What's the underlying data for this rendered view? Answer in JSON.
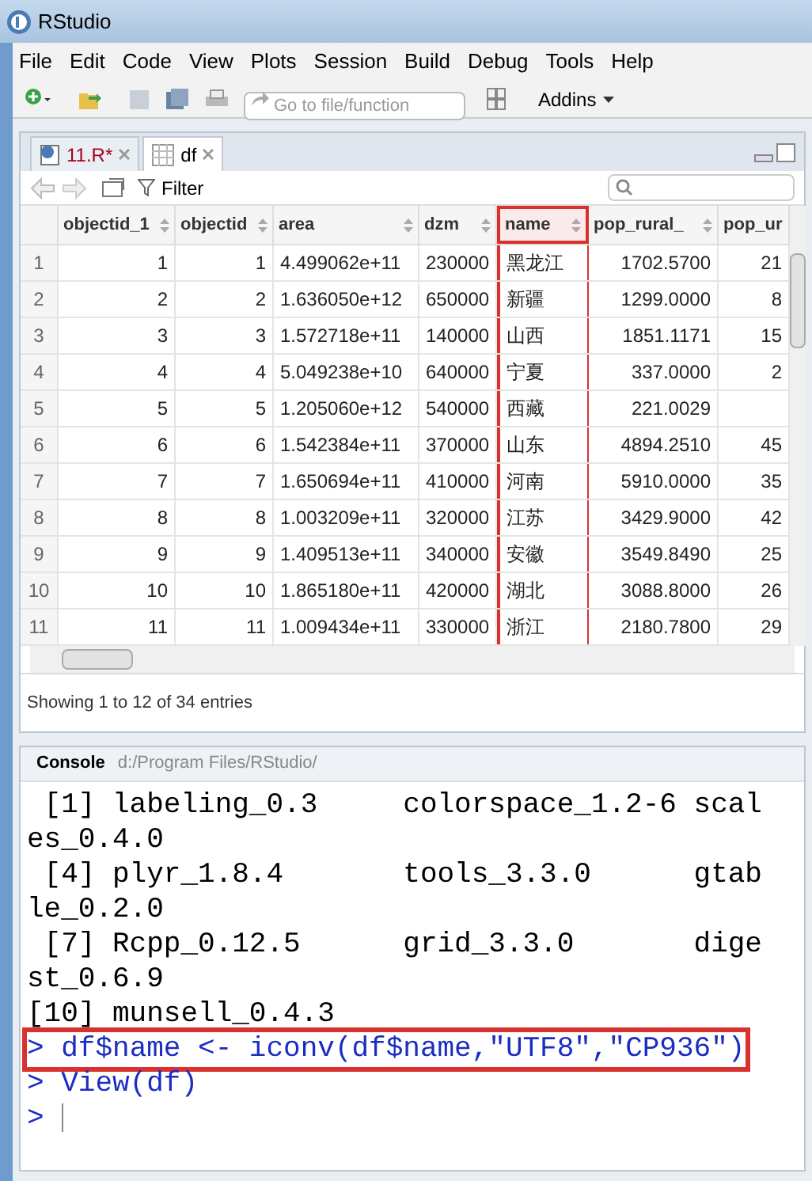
{
  "window": {
    "title": "RStudio"
  },
  "menu": [
    "File",
    "Edit",
    "Code",
    "View",
    "Plots",
    "Session",
    "Build",
    "Debug",
    "Tools",
    "Help"
  ],
  "toolbar": {
    "goto_placeholder": "Go to file/function",
    "addins": "Addins"
  },
  "tabs": [
    {
      "label": "11.R*",
      "kind": "script",
      "selected": false
    },
    {
      "label": "df",
      "kind": "data",
      "selected": true
    }
  ],
  "viewer": {
    "filter": "Filter",
    "columns": [
      {
        "label": "objectid_1",
        "kind": "integer",
        "highlighted": false
      },
      {
        "label": "objectid",
        "kind": "integer",
        "highlighted": false
      },
      {
        "label": "area",
        "kind": "scientific",
        "highlighted": false
      },
      {
        "label": "dzm",
        "kind": "code",
        "highlighted": false
      },
      {
        "label": "name",
        "kind": "text",
        "highlighted": true
      },
      {
        "label": "pop_rural_",
        "kind": "decimal",
        "highlighted": false
      },
      {
        "label": "pop_ur",
        "kind": "cut",
        "highlighted": false
      }
    ],
    "rows": [
      {
        "number": "1",
        "cells": [
          "1",
          "1",
          "4.499062e+11",
          "230000",
          "黑龙江",
          "1702.5700",
          "21"
        ]
      },
      {
        "number": "2",
        "cells": [
          "2",
          "2",
          "1.636050e+12",
          "650000",
          "新疆",
          "1299.0000",
          "8"
        ]
      },
      {
        "number": "3",
        "cells": [
          "3",
          "3",
          "1.572718e+11",
          "140000",
          "山西",
          "1851.1171",
          "15"
        ]
      },
      {
        "number": "4",
        "cells": [
          "4",
          "4",
          "5.049238e+10",
          "640000",
          "宁夏",
          "337.0000",
          "2"
        ]
      },
      {
        "number": "5",
        "cells": [
          "5",
          "5",
          "1.205060e+12",
          "540000",
          "西藏",
          "221.0029",
          ""
        ]
      },
      {
        "number": "6",
        "cells": [
          "6",
          "6",
          "1.542384e+11",
          "370000",
          "山东",
          "4894.2510",
          "45"
        ]
      },
      {
        "number": "7",
        "cells": [
          "7",
          "7",
          "1.650694e+11",
          "410000",
          "河南",
          "5910.0000",
          "35"
        ]
      },
      {
        "number": "8",
        "cells": [
          "8",
          "8",
          "1.003209e+11",
          "320000",
          "江苏",
          "3429.9000",
          "42"
        ]
      },
      {
        "number": "9",
        "cells": [
          "9",
          "9",
          "1.409513e+11",
          "340000",
          "安徽",
          "3549.8490",
          "25"
        ]
      },
      {
        "number": "10",
        "cells": [
          "10",
          "10",
          "1.865180e+11",
          "420000",
          "湖北",
          "3088.8000",
          "26"
        ]
      },
      {
        "number": "11",
        "cells": [
          "11",
          "11",
          "1.009434e+11",
          "330000",
          "浙江",
          "2180.7800",
          "29"
        ]
      }
    ],
    "status": "Showing 1 to 12 of 34 entries"
  },
  "console": {
    "title": "Console",
    "path": "d:/Program Files/RStudio/",
    "lines": [
      {
        "kind": "output",
        "text": " [1] labeling_0.3     colorspace_1.2-6 scal",
        "highlighted": false
      },
      {
        "kind": "output",
        "text": "es_0.4.0",
        "highlighted": false
      },
      {
        "kind": "output",
        "text": " [4] plyr_1.8.4       tools_3.3.0      gtab",
        "highlighted": false
      },
      {
        "kind": "output",
        "text": "le_0.2.0",
        "highlighted": false
      },
      {
        "kind": "output",
        "text": " [7] Rcpp_0.12.5      grid_3.3.0       dige",
        "highlighted": false
      },
      {
        "kind": "output",
        "text": "st_0.6.9",
        "highlighted": false
      },
      {
        "kind": "output",
        "text": "[10] munsell_0.4.3",
        "highlighted": false
      },
      {
        "kind": "command",
        "prompt": ">",
        "text": "df$name <- iconv(df$name,\"UTF8\",\"CP936\")",
        "highlighted": true
      },
      {
        "kind": "command",
        "prompt": ">",
        "text": "View(df)",
        "highlighted": false
      },
      {
        "kind": "input",
        "prompt": ">",
        "highlighted": false
      }
    ]
  }
}
